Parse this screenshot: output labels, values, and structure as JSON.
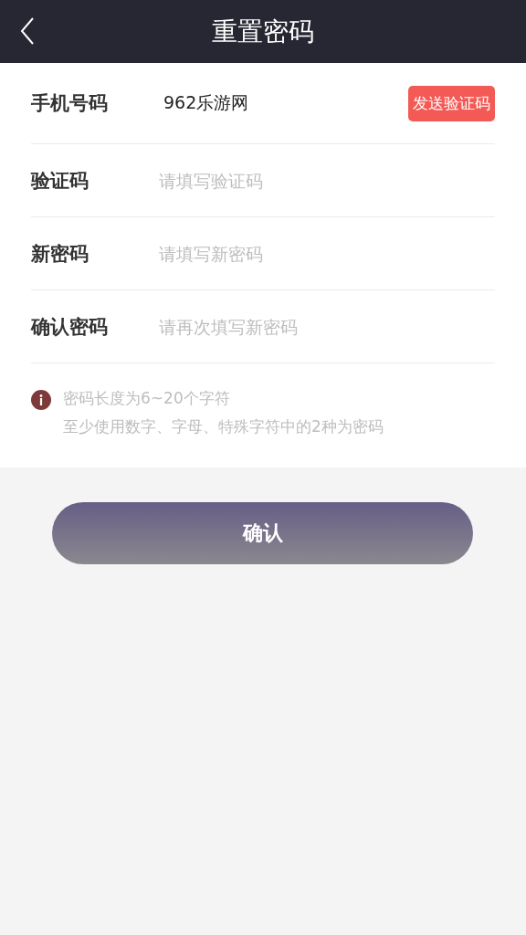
{
  "header": {
    "title": "重置密码"
  },
  "fields": [
    {
      "label": "手机号码",
      "value": "962乐游网",
      "action": "发送验证码"
    },
    {
      "label": "验证码",
      "placeholder": "请填写验证码"
    },
    {
      "label": "新密码",
      "placeholder": "请填写新密码"
    },
    {
      "label": "确认密码",
      "placeholder": "请再次填写新密码"
    }
  ],
  "hints": [
    "密码长度为6~20个字符",
    "至少使用数字、字母、特殊字符中的2种为密码"
  ],
  "confirm_button": "确认"
}
